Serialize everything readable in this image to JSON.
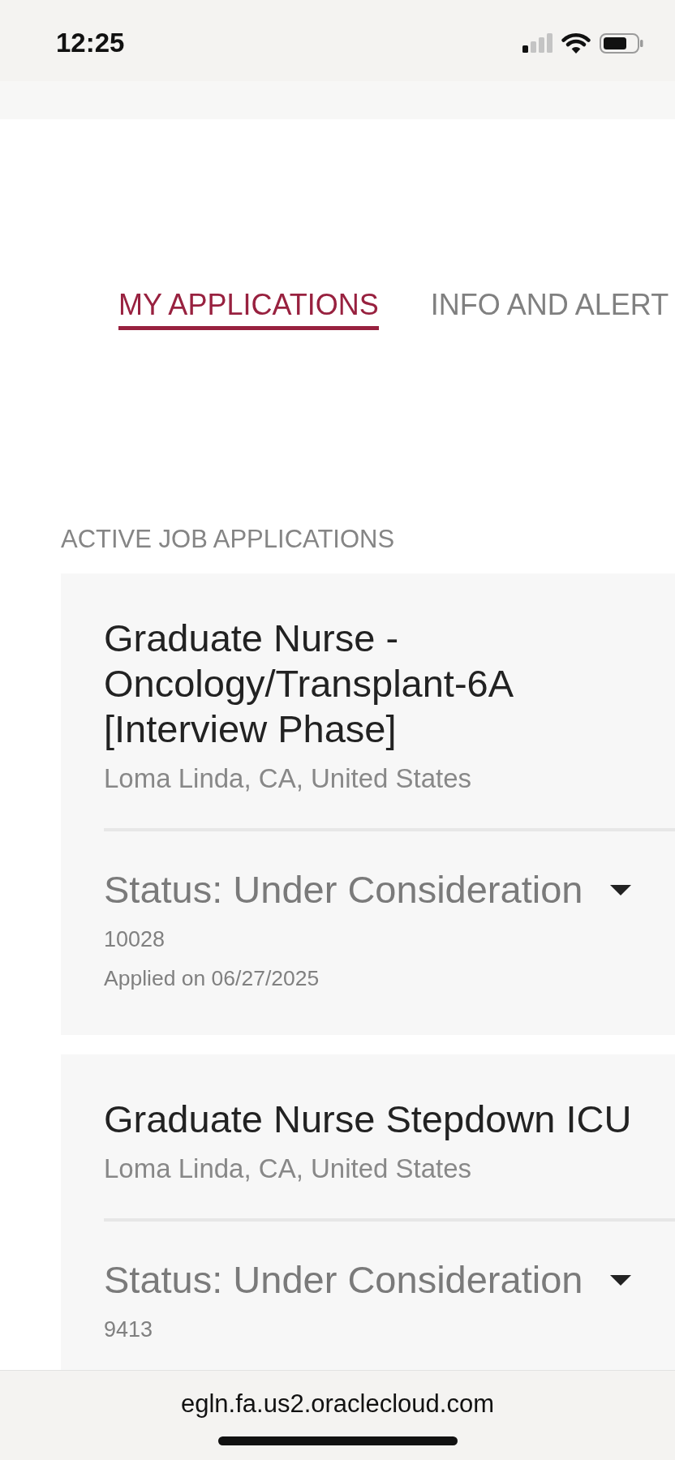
{
  "status_bar": {
    "time": "12:25"
  },
  "tabs": [
    {
      "label": "MY APPLICATIONS",
      "selected": true
    },
    {
      "label": "INFO AND ALERT",
      "selected": false
    }
  ],
  "section_heading": "ACTIVE JOB APPLICATIONS",
  "applications": [
    {
      "title": "Graduate Nurse - Oncology/Transplant-6A [Interview Phase]",
      "location": "Loma Linda, CA, United States",
      "status": "Status: Under Consideration",
      "expanded": false,
      "number": "10028",
      "applied": "Applied on 06/27/2025"
    },
    {
      "title": "Graduate Nurse Stepdown ICU",
      "location": "Loma Linda, CA, United States",
      "status": "Status: Under Consideration",
      "expanded": false,
      "number": "9413"
    }
  ],
  "browser_bar": {
    "url": "egln.fa.us2.oraclecloud.com"
  }
}
